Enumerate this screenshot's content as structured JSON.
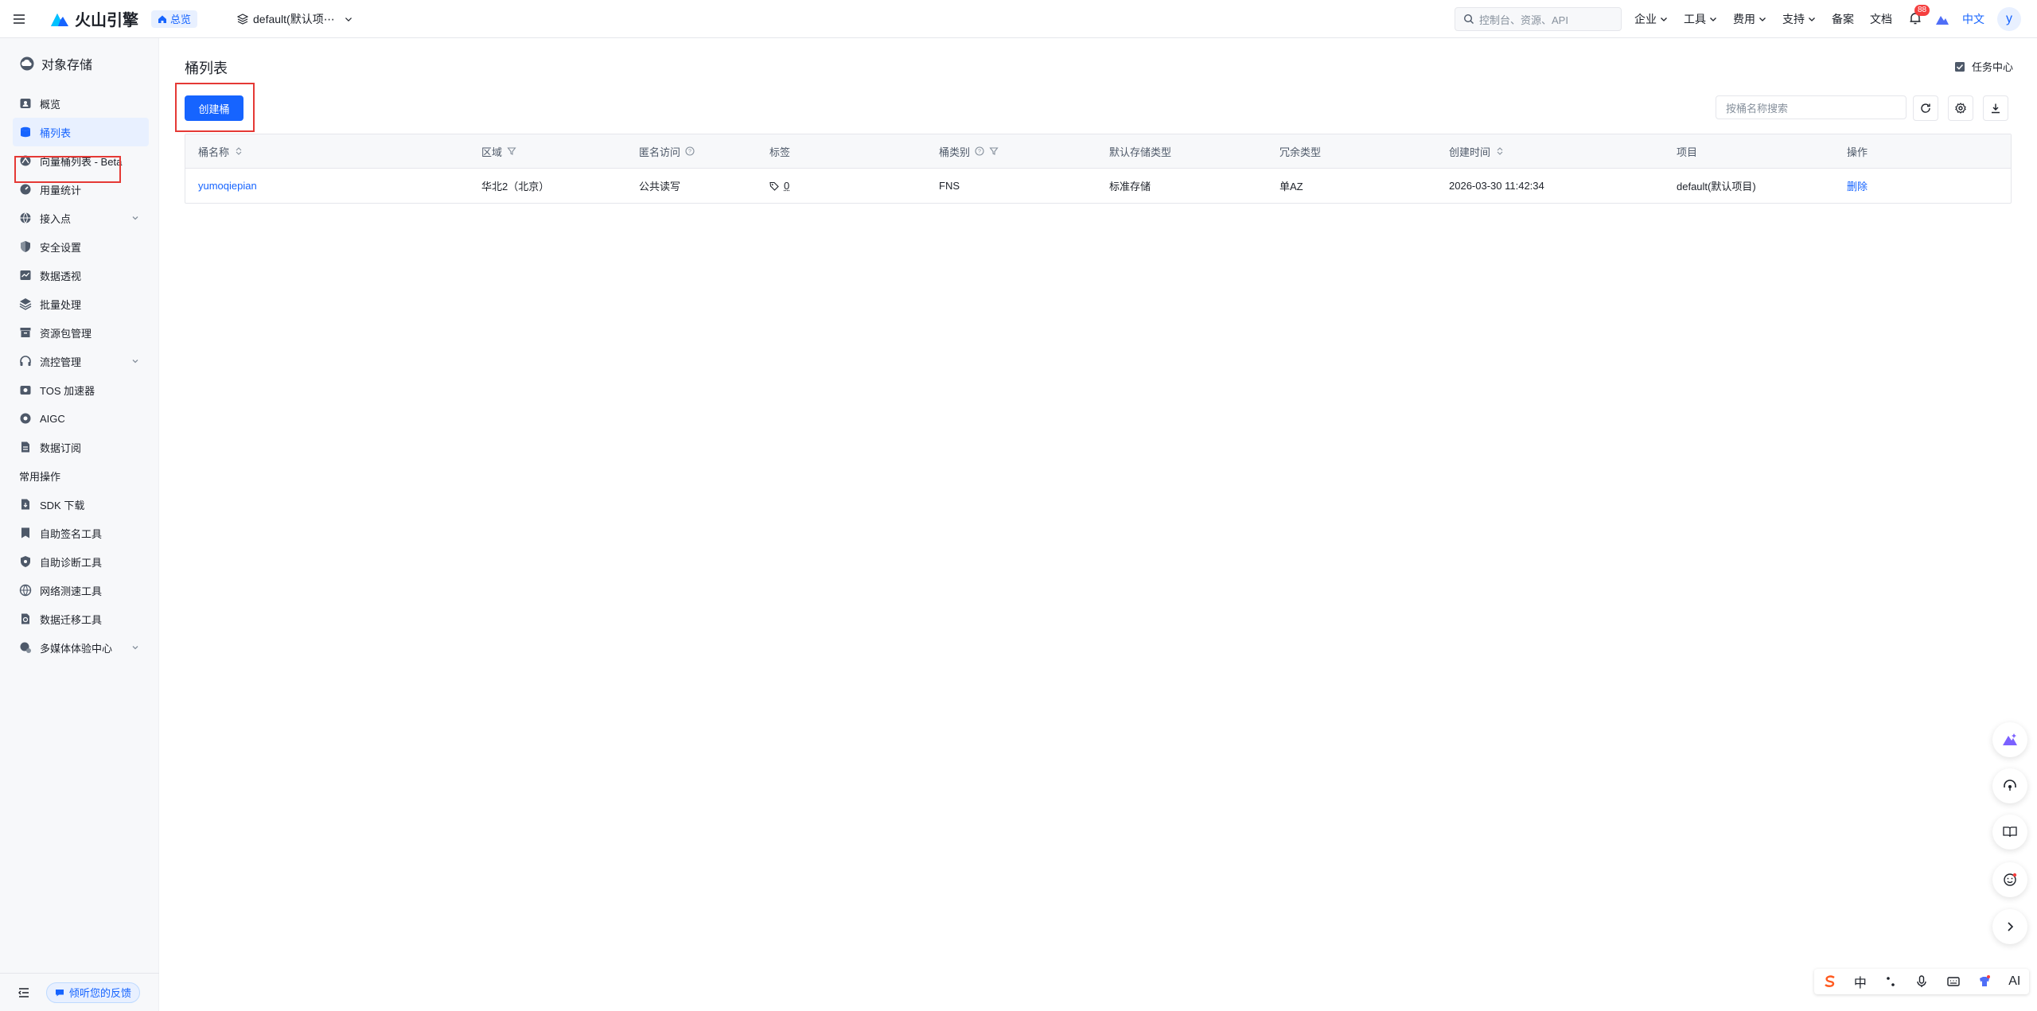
{
  "topbar": {
    "brand": "火山引擎",
    "home_chip": "总览",
    "project": "default(默认项⋯",
    "search_placeholder": "控制台、资源、API",
    "menus": [
      "企业",
      "工具",
      "费用",
      "支持"
    ],
    "links": [
      "备案",
      "文档"
    ],
    "notification_count": "88",
    "language": "中文",
    "avatar_letter": "y"
  },
  "sidebar": {
    "title": "对象存储",
    "items": [
      {
        "label": "概览",
        "icon": "overview-icon"
      },
      {
        "label": "桶列表",
        "icon": "bucket-icon",
        "active": true
      },
      {
        "label": "向量桶列表 - Beta",
        "icon": "vector-icon"
      },
      {
        "label": "用量统计",
        "icon": "gauge-icon"
      },
      {
        "label": "接入点",
        "icon": "globe-icon",
        "expandable": true
      },
      {
        "label": "安全设置",
        "icon": "shield-icon"
      },
      {
        "label": "数据透视",
        "icon": "chart-icon"
      },
      {
        "label": "批量处理",
        "icon": "layers-icon"
      },
      {
        "label": "资源包管理",
        "icon": "box-icon"
      },
      {
        "label": "流控管理",
        "icon": "headset-icon",
        "expandable": true
      },
      {
        "label": "TOS 加速器",
        "icon": "rocket-icon"
      },
      {
        "label": "AIGC",
        "icon": "aigc-icon"
      },
      {
        "label": "数据订阅",
        "icon": "file-icon"
      }
    ],
    "section": "常用操作",
    "tools": [
      {
        "label": "SDK 下载",
        "icon": "sdk-icon"
      },
      {
        "label": "自助签名工具",
        "icon": "bookmark-icon"
      },
      {
        "label": "自助诊断工具",
        "icon": "shield-check-icon"
      },
      {
        "label": "网络测速工具",
        "icon": "network-icon"
      },
      {
        "label": "数据迁移工具",
        "icon": "migrate-icon"
      },
      {
        "label": "多媒体体验中心",
        "icon": "media-icon",
        "expandable": true
      }
    ],
    "feedback": "倾听您的反馈"
  },
  "main": {
    "title": "桶列表",
    "task_center": "任务中心",
    "create_button": "创建桶",
    "search_placeholder": "按桶名称搜索",
    "table": {
      "headers": [
        "桶名称",
        "区域",
        "匿名访问",
        "标签",
        "桶类别",
        "默认存储类型",
        "冗余类型",
        "创建时间",
        "项目",
        "操作"
      ],
      "rows": [
        {
          "name": "yumoqiepian",
          "region": "华北2（北京）",
          "anonymous": "公共读写",
          "tags": "0",
          "category": "FNS",
          "storage_class": "标准存储",
          "redundancy": "单AZ",
          "created": "2026-03-30 11:42:34",
          "project": "default(默认项目)",
          "action": "删除"
        }
      ]
    }
  },
  "ime": {
    "mode": "中",
    "ai_label": "AI"
  },
  "colors": {
    "primary": "#1664ff",
    "highlight_box": "#e53935"
  }
}
